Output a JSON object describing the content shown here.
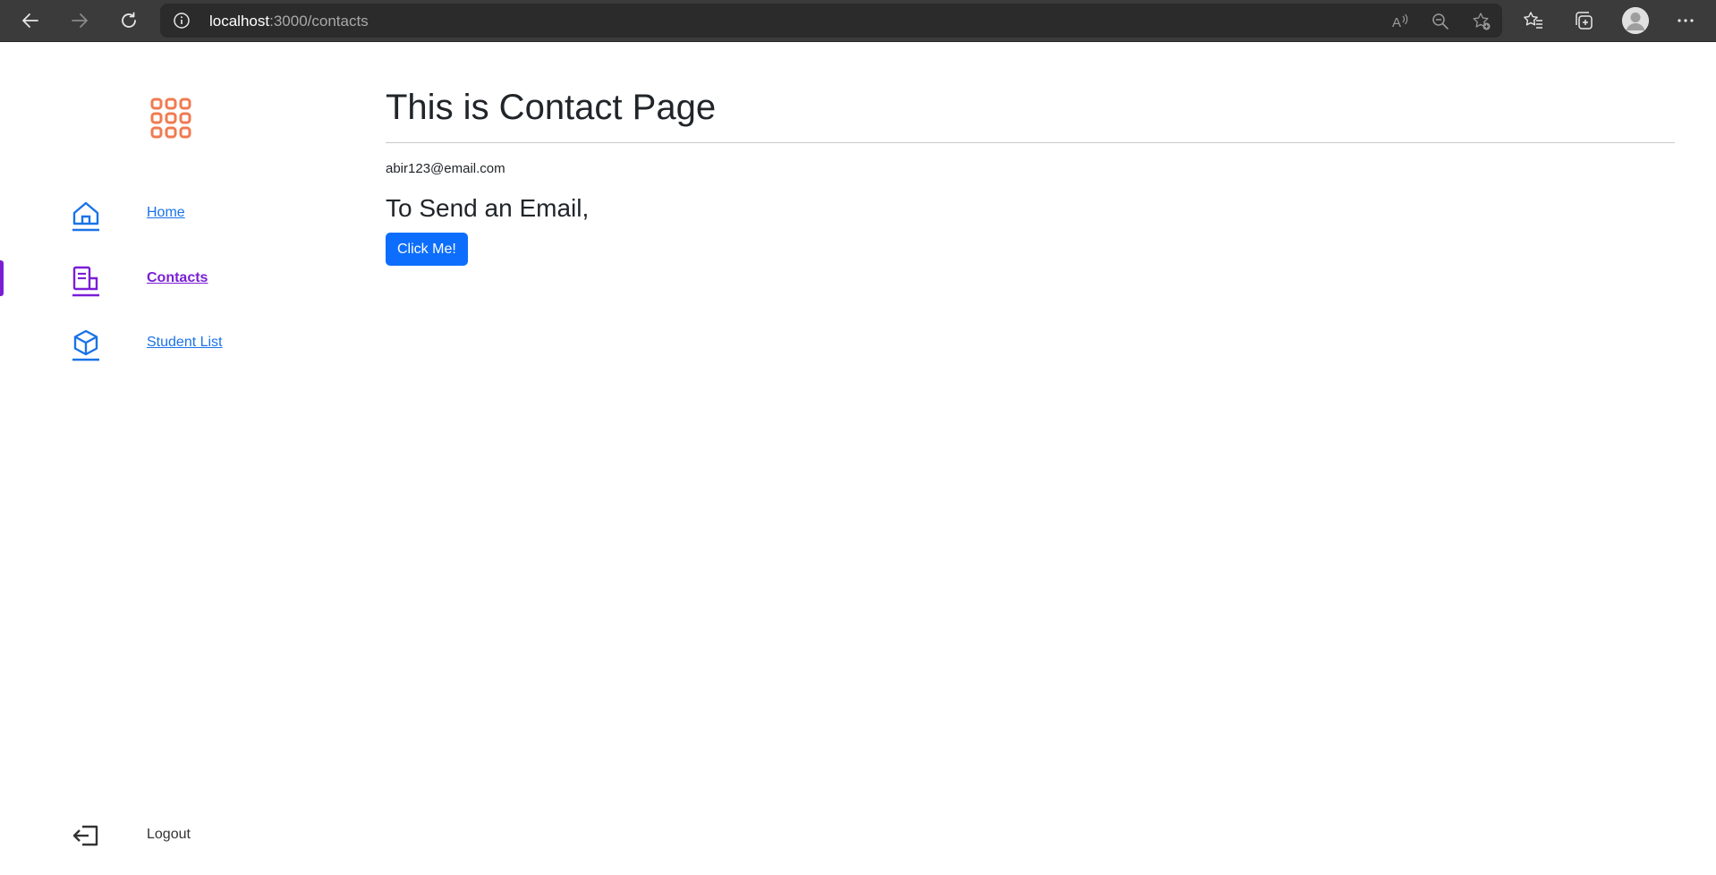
{
  "browser": {
    "url_host": "localhost",
    "url_path": ":3000/contacts",
    "icons": [
      "back-arrow-icon",
      "forward-arrow-icon",
      "refresh-icon",
      "site-info-icon",
      "read-aloud-icon",
      "zoom-out-icon",
      "add-favorite-icon",
      "favorites-icon",
      "collections-icon",
      "profile-avatar",
      "more-options-icon"
    ]
  },
  "sidebar": {
    "logo_icon": "app-grid-icon",
    "items": [
      {
        "label": "Home",
        "icon": "home-icon"
      },
      {
        "label": "Contacts",
        "icon": "contacts-icon",
        "active": true
      },
      {
        "label": "Student List",
        "icon": "cube-icon"
      }
    ],
    "logout_label": "Logout"
  },
  "main": {
    "title": "This is Contact Page",
    "email": "abir123@email.com",
    "subheading": "To Send an Email,",
    "button_label": "Click Me!"
  },
  "colors": {
    "chrome_bg": "#3b3b3b",
    "accent_blue": "#0d6efd",
    "link_blue": "#1a73e8",
    "active_purple": "#7a1ed6",
    "logo_orange": "#f07a50"
  }
}
